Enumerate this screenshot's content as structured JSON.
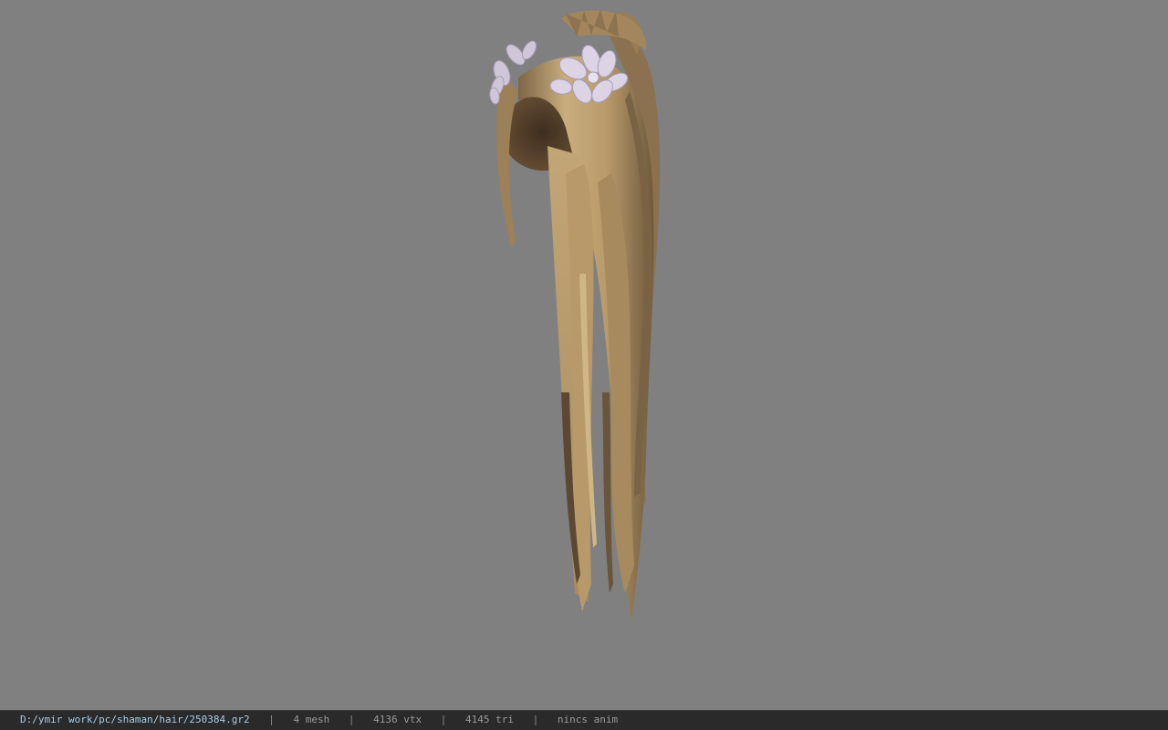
{
  "viewport": {
    "background_color": "#808080",
    "model_name": "long hair model with flower crown"
  },
  "status_bar": {
    "path": "D:/ymir work/pc/shaman/hair/250384.gr2",
    "mesh_count": "4 mesh",
    "vertex_count": "4136 vtx",
    "triangle_count": "4145 tri",
    "animation": "nincs anim",
    "separator": "|",
    "path_color": "#a9cbe6"
  }
}
